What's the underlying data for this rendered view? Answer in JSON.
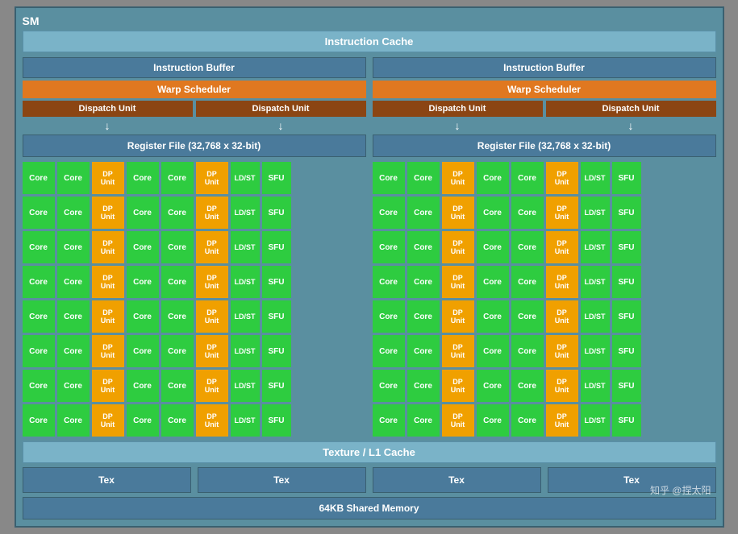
{
  "sm": {
    "label": "SM",
    "instruction_cache": "Instruction Cache",
    "left": {
      "instruction_buffer": "Instruction Buffer",
      "warp_scheduler": "Warp Scheduler",
      "dispatch_unit_1": "Dispatch Unit",
      "dispatch_unit_2": "Dispatch Unit",
      "register_file": "Register File (32,768 x 32-bit)"
    },
    "right": {
      "instruction_buffer": "Instruction Buffer",
      "warp_scheduler": "Warp Scheduler",
      "dispatch_unit_1": "Dispatch Unit",
      "dispatch_unit_2": "Dispatch Unit",
      "register_file": "Register File (32,768 x 32-bit)"
    },
    "core_label": "Core",
    "dp_label": "DP\nUnit",
    "ldst_label": "LD/ST",
    "sfu_label": "SFU",
    "num_rows": 8,
    "texture_cache": "Texture / L1 Cache",
    "tex_label": "Tex",
    "shared_memory": "64KB Shared Memory",
    "watermark": "知乎 @捏太阳"
  }
}
